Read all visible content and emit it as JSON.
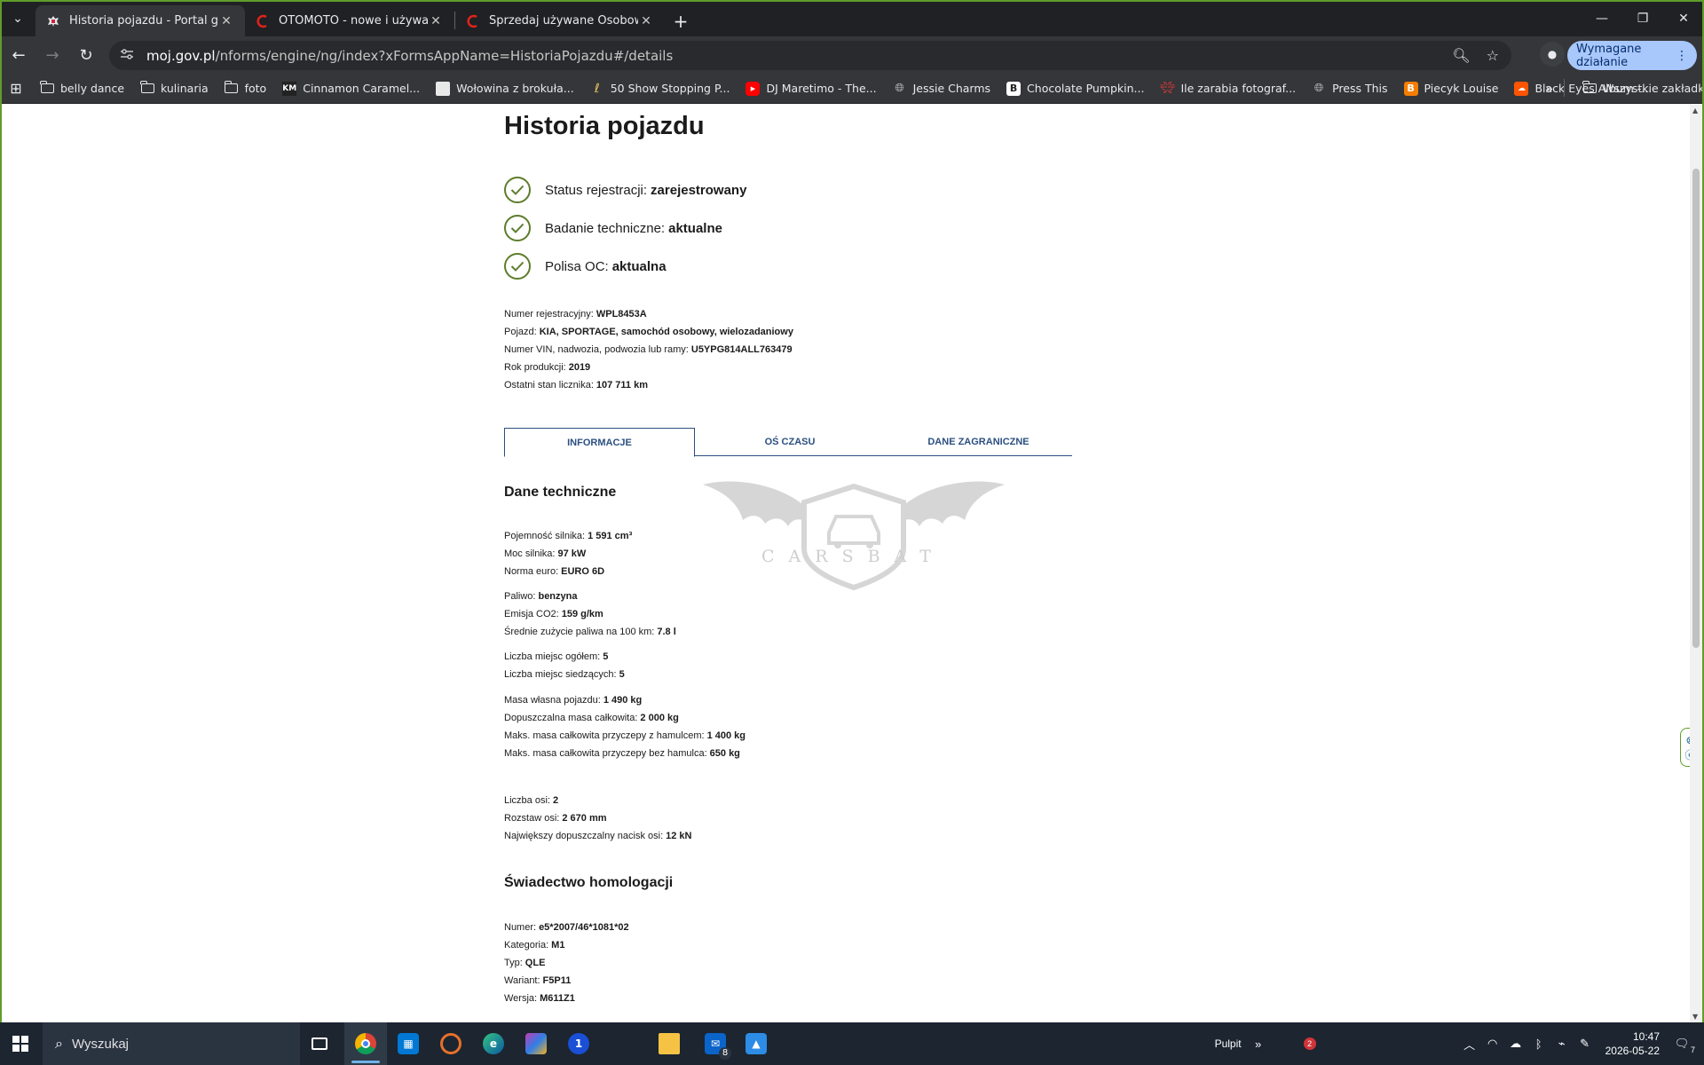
{
  "browser": {
    "tabs": [
      {
        "title": "Historia pojazdu - Portal gov.pl",
        "active": true
      },
      {
        "title": "OTOMOTO - nowe i używane sa",
        "active": false
      },
      {
        "title": "Sprzedaj używane Osobowe | O",
        "active": false
      }
    ],
    "url_host": "moj.gov.pl",
    "url_path": "/nforms/engine/ng/index?xFormsAppName=HistoriaPojazdu#/details",
    "action_button": "Wymagane działanie",
    "bookmarks": [
      {
        "label": "belly dance",
        "icon": "folder-icon"
      },
      {
        "label": "kulinaria",
        "icon": "folder-icon"
      },
      {
        "label": "foto",
        "icon": "folder-icon"
      },
      {
        "label": "Cinnamon Caramel...",
        "icon": "km-icon"
      },
      {
        "label": "Wołowina z brokuła...",
        "icon": "image-icon"
      },
      {
        "label": "50 Show Stopping P...",
        "icon": "leaf-icon"
      },
      {
        "label": "DJ Maretimo - The...",
        "icon": "youtube-icon"
      },
      {
        "label": "Jessie Charms",
        "icon": "globe-icon"
      },
      {
        "label": "Chocolate Pumpkin...",
        "icon": "b-icon"
      },
      {
        "label": "Ile zarabia fotograf...",
        "icon": "space-invader-icon"
      },
      {
        "label": "Press This",
        "icon": "globe-icon"
      },
      {
        "label": "Piecyk Louise",
        "icon": "blogger-icon"
      },
      {
        "label": "Black Eyes Album -...",
        "icon": "soundcloud-icon"
      }
    ],
    "all_bookmarks": "Wszystkie zakładki"
  },
  "page": {
    "title": "Historia pojazdu",
    "statuses": [
      {
        "label": "Status rejestracji:",
        "value": "zarejestrowany"
      },
      {
        "label": "Badanie techniczne:",
        "value": "aktualne"
      },
      {
        "label": "Polisa OC:",
        "value": "aktualna"
      }
    ],
    "vehicle": [
      {
        "label": "Numer rejestracyjny:",
        "value": "WPL8453A"
      },
      {
        "label": "Pojazd:",
        "value": "KIA, SPORTAGE, samochód osobowy, wielozadaniowy"
      },
      {
        "label": "Numer VIN, nadwozia, podwozia lub ramy:",
        "value": "U5YPG814ALL763479"
      },
      {
        "label": "Rok produkcji:",
        "value": "2019"
      },
      {
        "label": "Ostatni stan licznika:",
        "value": "107 711 km"
      }
    ],
    "tabs": [
      {
        "label": "INFORMACJE",
        "active": true
      },
      {
        "label": "OŚ CZASU",
        "active": false
      },
      {
        "label": "DANE ZAGRANICZNE",
        "active": false
      }
    ],
    "tech_title": "Dane techniczne",
    "tech_groups": [
      [
        {
          "label": "Pojemność silnika:",
          "value": "1 591 cm³"
        },
        {
          "label": "Moc silnika:",
          "value": "97 kW"
        },
        {
          "label": "Norma euro:",
          "value": "EURO 6D"
        }
      ],
      [
        {
          "label": "Paliwo:",
          "value": "benzyna"
        },
        {
          "label": "Emisja CO2:",
          "value": "159 g/km"
        },
        {
          "label": "Średnie zużycie paliwa na 100 km:",
          "value": "7.8 l"
        }
      ],
      [
        {
          "label": "Liczba miejsc ogółem:",
          "value": "5"
        },
        {
          "label": "Liczba miejsc siedzących:",
          "value": "5"
        }
      ],
      [
        {
          "label": "Masa własna pojazdu:",
          "value": "1 490 kg"
        },
        {
          "label": "Dopuszczalna masa całkowita:",
          "value": "2 000 kg"
        },
        {
          "label": "Maks. masa całkowita przyczepy z hamulcem:",
          "value": "1 400 kg"
        },
        {
          "label": "Maks. masa całkowita przyczepy bez hamulca:",
          "value": "650 kg"
        }
      ],
      [
        {
          "label": "Liczba osi:",
          "value": "2"
        },
        {
          "label": "Rozstaw osi:",
          "value": "2 670 mm"
        },
        {
          "label": "Największy dopuszczalny nacisk osi:",
          "value": "12 kN"
        }
      ]
    ],
    "homolog_title": "Świadectwo homologacji",
    "homolog": [
      {
        "label": "Numer:",
        "value": "e5*2007/46*1081*02"
      },
      {
        "label": "Kategoria:",
        "value": "M1"
      },
      {
        "label": "Typ:",
        "value": "QLE"
      },
      {
        "label": "Wariant:",
        "value": "F5P11"
      },
      {
        "label": "Wersja:",
        "value": "M611Z1"
      }
    ],
    "watermark": "CARSBAT"
  },
  "taskbar": {
    "search_placeholder": "Wyszukaj",
    "desktop_label": "Pulpit",
    "notification_count": "2",
    "time": "10:47",
    "date": "2026-05-22",
    "mail_badge": "8",
    "action_center_count": "7"
  },
  "colors": {
    "window_border": "#5f9e29",
    "check_green": "#5d7d2b",
    "tab_blue": "#2b4f80"
  }
}
